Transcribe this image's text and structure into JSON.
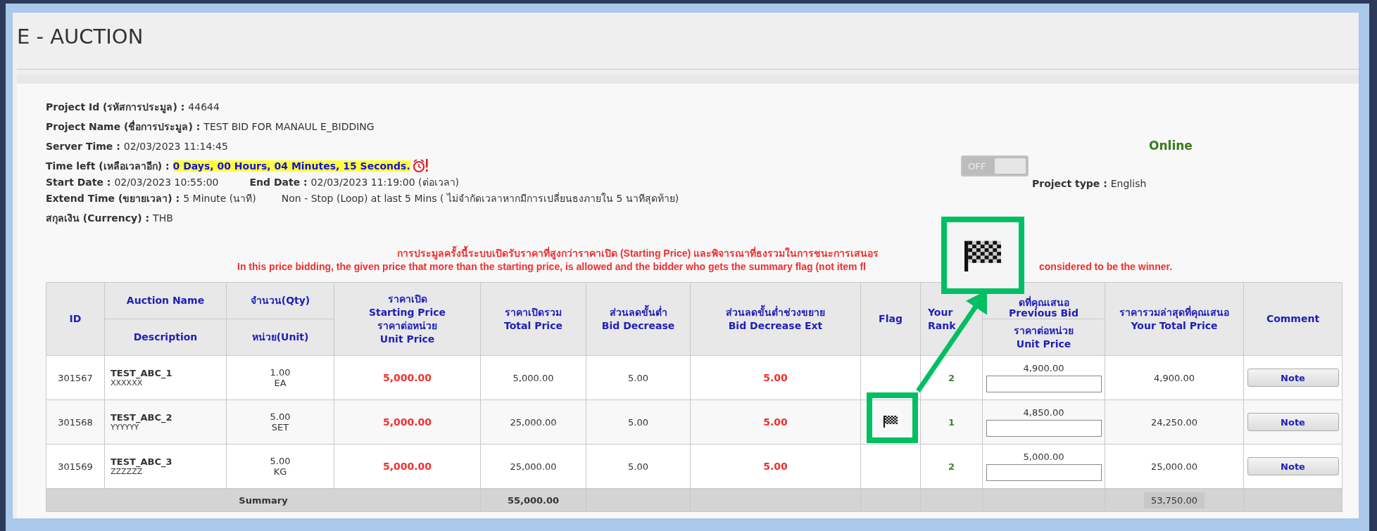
{
  "title": "E - AUCTION",
  "info": {
    "project_id": {
      "label": "Project Id (รหัสการประมูล) :",
      "value": "44644"
    },
    "project_name": {
      "label": "Project Name (ชื่อการประมูล) :",
      "value": "TEST BID FOR MANAUL E_BIDDING"
    },
    "server_time": {
      "label": "Server Time :",
      "value": "02/03/2023 11:14:45"
    },
    "time_left": {
      "label": "Time left (เหลือเวลาอีก) :",
      "value": "0 Days, 00 Hours, 04 Minutes, 15 Seconds."
    },
    "start_date": {
      "label": "Start Date :",
      "value": "02/03/2023 10:55:00"
    },
    "end_date": {
      "label": "End Date :",
      "value": "02/03/2023 11:19:00 (ต่อเวลา)"
    },
    "extend_time": {
      "label": "Extend Time (ขยายเวลา) :",
      "value": "5  Minute (นาที)",
      "note": "Non - Stop (Loop) at last 5 Mins ( ไม่จำกัดเวลาหากมีการเปลี่ยนธงภายใน 5 นาทีสุดท้าย)"
    },
    "currency": {
      "label": "สกุลเงิน (Currency) :",
      "value": "THB"
    }
  },
  "status": "Online",
  "toggle": {
    "label": "OFF",
    "on": false
  },
  "project_type": {
    "label": "Project type :",
    "value": "English"
  },
  "notice": {
    "thai": "การประมูลครั้งนี้ระบบเปิดรับราคาที่สูงกว่าราคาเปิด (Starting Price) และพิจารณาที่ธงรวมในการชนะการเสนอร",
    "english_start": "In this price bidding, the given price that more than the starting price, is allowed and the bidder who gets the summary flag (not item fl",
    "english_end": "considered to be the winner."
  },
  "table": {
    "headers": {
      "id": "ID",
      "name": "Auction Name",
      "description": "Description",
      "qty": "จำนวน(Qty)",
      "unit": "หน่วย(Unit)",
      "starting_price": [
        "ราคาเปิด",
        "Starting Price",
        "ราคาต่อหน่วย",
        "Unit Price"
      ],
      "total_price": [
        "ราคาเปิดรวม",
        "Total Price"
      ],
      "bid_decrease": [
        "ส่วนลดขั้นต่ำ",
        "Bid Decrease"
      ],
      "bid_decrease_ext": [
        "ส่วนลดขั้นต่ำช่วงขยาย",
        "Bid Decrease Ext"
      ],
      "flag": "Flag",
      "rank": [
        "Your",
        "Rank"
      ],
      "previous_bid": [
        "ดที่คุณเสนอ",
        "Previous Bid"
      ],
      "unit_price": [
        "ราคาต่อหน่วย",
        "Unit Price"
      ],
      "your_total": [
        "ราคารวมล่าสุดที่คุณเสนอ",
        "Your Total Price"
      ],
      "comment": "Comment"
    },
    "rows": [
      {
        "id": "301567",
        "name": "TEST_ABC_1",
        "description": "XXXXXX",
        "qty": "1.00",
        "unit": "EA",
        "starting_price": "5,000.00",
        "total_price": "5,000.00",
        "bid_decrease": "5.00",
        "bid_decrease_ext": "5.00",
        "flag": false,
        "rank": "2",
        "previous_bid": "4,900.00",
        "your_total": "4,900.00",
        "comment": "Note"
      },
      {
        "id": "301568",
        "name": "TEST_ABC_2",
        "description": "YYYYYY",
        "qty": "5.00",
        "unit": "SET",
        "starting_price": "5,000.00",
        "total_price": "25,000.00",
        "bid_decrease": "5.00",
        "bid_decrease_ext": "5.00",
        "flag": true,
        "rank": "1",
        "previous_bid": "4,850.00",
        "your_total": "24,250.00",
        "comment": "Note"
      },
      {
        "id": "301569",
        "name": "TEST_ABC_3",
        "description": "ZZZZZZ",
        "qty": "5.00",
        "unit": "KG",
        "starting_price": "5,000.00",
        "total_price": "25,000.00",
        "bid_decrease": "5.00",
        "bid_decrease_ext": "5.00",
        "flag": false,
        "rank": "2",
        "previous_bid": "5,000.00",
        "your_total": "25,000.00",
        "comment": "Note"
      }
    ],
    "summary": {
      "label": "Summary",
      "total_price": "55,000.00",
      "your_total": "53,750.00"
    }
  },
  "callout": {
    "shown": true
  }
}
